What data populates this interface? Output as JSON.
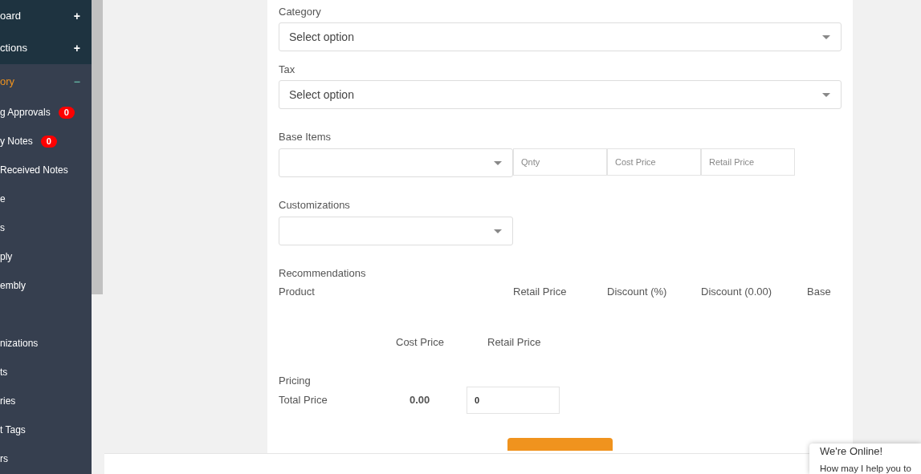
{
  "sidebar": {
    "items": [
      {
        "label": "oard",
        "kind": "module",
        "toggle": "+",
        "selected": false
      },
      {
        "label": "ctions",
        "kind": "module",
        "toggle": "+",
        "selected": false
      },
      {
        "label": "ory",
        "kind": "module",
        "toggle": "−",
        "selected": true
      },
      {
        "label": "g Approvals",
        "kind": "link",
        "badge": "0",
        "selected": false
      },
      {
        "label": "y Notes",
        "kind": "link",
        "badge": "0",
        "selected": false
      },
      {
        "label": "Received Notes",
        "kind": "link",
        "selected": false
      },
      {
        "label": "e",
        "kind": "link",
        "selected": false
      },
      {
        "label": "s",
        "kind": "link",
        "selected": false
      },
      {
        "label": "ply",
        "kind": "link",
        "selected": false
      },
      {
        "label": "embly",
        "kind": "link",
        "selected": false
      },
      {
        "kind": "spacer"
      },
      {
        "label": "nizations",
        "kind": "link",
        "selected": false
      },
      {
        "label": "ts",
        "kind": "link",
        "selected": false
      },
      {
        "label": "ries",
        "kind": "link",
        "selected": false
      },
      {
        "label": "t Tags",
        "kind": "link",
        "selected": false
      },
      {
        "label": "rs",
        "kind": "link",
        "selected": false
      }
    ]
  },
  "form": {
    "category": {
      "label": "Category",
      "placeholder": "Select option"
    },
    "tax": {
      "label": "Tax",
      "placeholder": "Select option"
    },
    "base_items": {
      "label": "Base Items",
      "inputs": [
        {
          "placeholder": "Qnty"
        },
        {
          "placeholder": "Cost Price"
        },
        {
          "placeholder": "Retail Price"
        }
      ]
    },
    "customizations": {
      "label": "Customizations"
    },
    "recommendations": {
      "label": "Recommendations",
      "columns": [
        "Product",
        "Retail Price",
        "Discount (%)",
        "Discount (0.00)",
        "Base"
      ],
      "sub_columns": [
        "Cost Price",
        "Retail Price"
      ]
    },
    "pricing": {
      "label": "Pricing",
      "total_label": "Total Price",
      "total_value": "0.00",
      "retail_value": "0"
    }
  },
  "chat": {
    "title": "We're Online!",
    "message": "How may I help you to"
  }
}
